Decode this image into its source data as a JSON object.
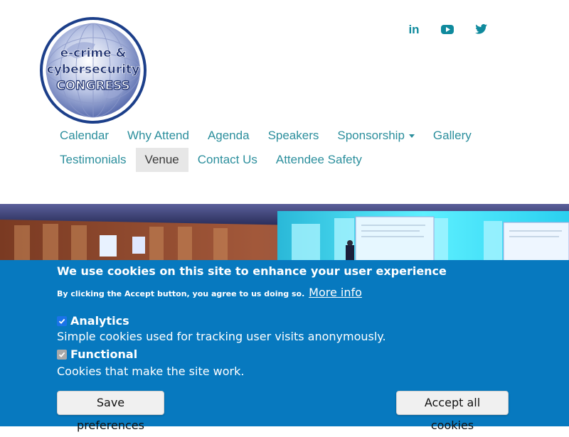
{
  "logo": {
    "line1": "e-crime &",
    "line2": "cybersecurity",
    "line3": "CONGRESS"
  },
  "social": [
    {
      "icon": "linkedin-icon",
      "text": "in"
    },
    {
      "icon": "youtube-icon"
    },
    {
      "icon": "twitter-icon"
    }
  ],
  "nav": {
    "items": [
      {
        "label": "Calendar"
      },
      {
        "label": "Why Attend"
      },
      {
        "label": "Agenda"
      },
      {
        "label": "Speakers"
      },
      {
        "label": "Sponsorship"
      },
      {
        "label": "Gallery"
      },
      {
        "label": "Testimonials"
      },
      {
        "label": "Venue",
        "active": true
      },
      {
        "label": "Contact Us"
      },
      {
        "label": "Attendee Safety"
      }
    ]
  },
  "cookie": {
    "title": "We use cookies on this site to enhance your user experience",
    "subtitle": "By clicking the Accept button, you agree to us doing so.",
    "more_info": "More info",
    "options": [
      {
        "label": "Analytics",
        "checked": true,
        "disabled": false,
        "description": "Simple cookies used for tracking user visits anonymously."
      },
      {
        "label": "Functional",
        "checked": true,
        "disabled": true,
        "description": "Cookies that make the site work."
      }
    ],
    "save_button": "Save preferences",
    "accept_button": "Accept all cookies"
  },
  "colors": {
    "accent": "#2c8f9d",
    "cookie_bg": "#0779bf",
    "logo_ring": "#1c3f8a"
  }
}
